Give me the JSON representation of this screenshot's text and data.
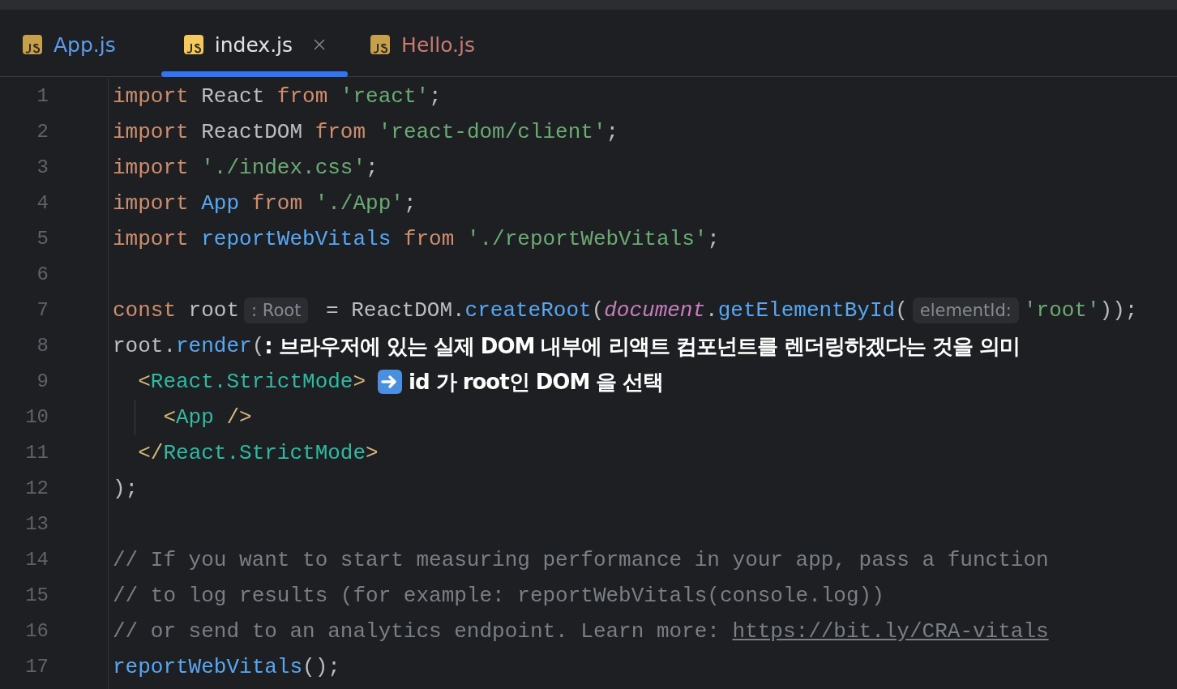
{
  "tabs": [
    {
      "label": "App.js",
      "selected": false,
      "color": "#5c9ded"
    },
    {
      "label": "index.js",
      "selected": true,
      "color": "#dfe1e5"
    },
    {
      "label": "Hello.js",
      "selected": false,
      "color": "#c77a72"
    }
  ],
  "lines": [
    {
      "number": "1",
      "guide": false,
      "tokens": [
        {
          "kind": "keyword",
          "text": "import"
        },
        {
          "kind": "plain",
          "text": " React "
        },
        {
          "kind": "keyword",
          "text": "from"
        },
        {
          "kind": "string",
          "text": " 'react'"
        },
        {
          "kind": "plain",
          "text": ";"
        }
      ]
    },
    {
      "number": "2",
      "guide": false,
      "tokens": [
        {
          "kind": "keyword",
          "text": "import"
        },
        {
          "kind": "plain",
          "text": " ReactDOM "
        },
        {
          "kind": "keyword",
          "text": "from"
        },
        {
          "kind": "string",
          "text": " 'react-dom/client'"
        },
        {
          "kind": "plain",
          "text": ";"
        }
      ]
    },
    {
      "number": "3",
      "guide": false,
      "tokens": [
        {
          "kind": "keyword",
          "text": "import"
        },
        {
          "kind": "string",
          "text": " './index.css'"
        },
        {
          "kind": "plain",
          "text": ";"
        }
      ]
    },
    {
      "number": "4",
      "guide": false,
      "tokens": [
        {
          "kind": "keyword",
          "text": "import"
        },
        {
          "kind": "func",
          "text": " App"
        },
        {
          "kind": "keyword",
          "text": " from"
        },
        {
          "kind": "string",
          "text": " './App'"
        },
        {
          "kind": "plain",
          "text": ";"
        }
      ]
    },
    {
      "number": "5",
      "guide": false,
      "tokens": [
        {
          "kind": "keyword",
          "text": "import"
        },
        {
          "kind": "func",
          "text": " reportWebVitals"
        },
        {
          "kind": "keyword",
          "text": " from"
        },
        {
          "kind": "string",
          "text": " './reportWebVitals'"
        },
        {
          "kind": "plain",
          "text": ";"
        }
      ]
    },
    {
      "number": "6",
      "guide": false
    },
    {
      "number": "7",
      "guide": false,
      "tokens": [
        {
          "kind": "keyword",
          "text": "const"
        },
        {
          "kind": "plain",
          "text": " root"
        },
        {
          "kind": "hint",
          "text": ": Root"
        },
        {
          "kind": "plain",
          "text": " = ReactDOM."
        },
        {
          "kind": "func",
          "text": "createRoot"
        },
        {
          "kind": "plain",
          "text": "("
        },
        {
          "kind": "global",
          "text": "document"
        },
        {
          "kind": "plain",
          "text": "."
        },
        {
          "kind": "func",
          "text": "getElementById"
        },
        {
          "kind": "plain",
          "text": "("
        },
        {
          "kind": "hint",
          "text": "elementId:"
        },
        {
          "kind": "string",
          "text": "'root'"
        },
        {
          "kind": "plain",
          "text": "));"
        }
      ]
    },
    {
      "number": "8",
      "guide": false,
      "tokens": [
        {
          "kind": "plain",
          "text": "root."
        },
        {
          "kind": "func",
          "text": "render"
        },
        {
          "kind": "plain",
          "text": "("
        },
        {
          "kind": "note",
          "text": ": 브라우저에 있는 실제 DOM 내부에 리액트 컴포넌트를 렌더링하겠다는 것을 의미"
        }
      ]
    },
    {
      "number": "9",
      "guide": false,
      "tokens": [
        {
          "kind": "bracket",
          "text": "  <"
        },
        {
          "kind": "tag",
          "text": "React.StrictMode"
        },
        {
          "kind": "bracket",
          "text": ">"
        },
        {
          "kind": "arrow_icon"
        },
        {
          "kind": "note",
          "text": "id 가 root인 DOM 을 선택"
        }
      ]
    },
    {
      "number": "10",
      "guide": true,
      "tokens": [
        {
          "kind": "bracket",
          "text": "    <"
        },
        {
          "kind": "tag",
          "text": "App"
        },
        {
          "kind": "bracket",
          "text": " />"
        }
      ]
    },
    {
      "number": "11",
      "guide": false,
      "tokens": [
        {
          "kind": "bracket",
          "text": "  </"
        },
        {
          "kind": "tag",
          "text": "React.StrictMode"
        },
        {
          "kind": "bracket",
          "text": ">"
        }
      ]
    },
    {
      "number": "12",
      "guide": false,
      "tokens": [
        {
          "kind": "plain",
          "text": ");"
        }
      ]
    },
    {
      "number": "13",
      "guide": false
    },
    {
      "number": "14",
      "guide": false,
      "tokens": [
        {
          "kind": "comment",
          "text": "// If you want to start measuring performance in your app, pass a function"
        }
      ]
    },
    {
      "number": "15",
      "guide": false,
      "tokens": [
        {
          "kind": "comment",
          "text": "// to log results (for example: reportWebVitals(console.log))"
        }
      ]
    },
    {
      "number": "16",
      "guide": false,
      "tokens": [
        {
          "kind": "comment",
          "text": "// or send to an analytics endpoint. Learn more: "
        },
        {
          "kind": "link",
          "text": "https://bit.ly/CRA-vitals"
        }
      ]
    },
    {
      "number": "17",
      "guide": false,
      "tokens": [
        {
          "kind": "func",
          "text": "reportWebVitals"
        },
        {
          "kind": "plain",
          "text": "();"
        }
      ]
    }
  ]
}
